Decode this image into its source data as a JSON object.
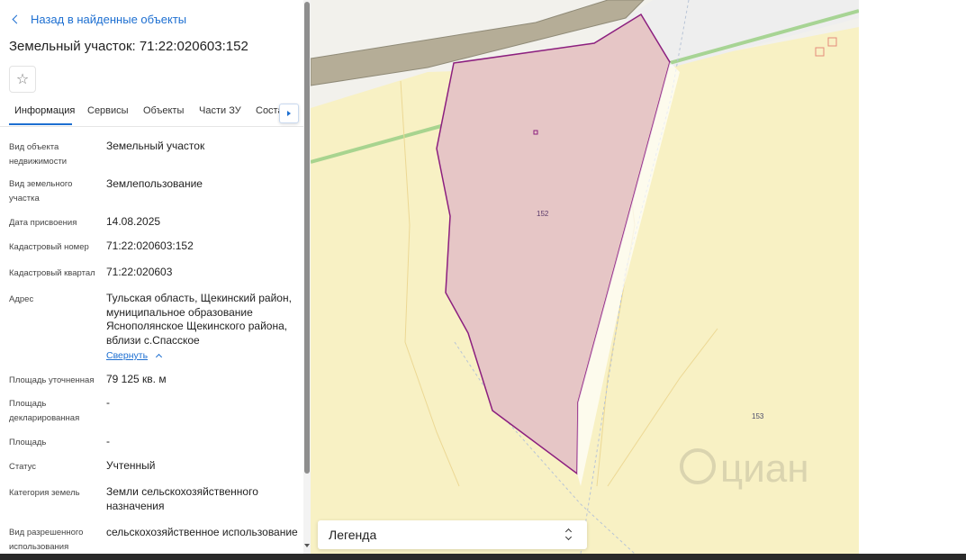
{
  "panel": {
    "back_link": "Назад в найденные объекты",
    "title": "Земельный участок: 71:22:020603:152",
    "tabs": [
      "Информация",
      "Сервисы",
      "Объекты",
      "Части ЗУ",
      "Соста"
    ],
    "active_tab": 0,
    "rows": [
      {
        "label": "Вид объекта недвижимости",
        "value": "Земельный участок"
      },
      {
        "label": "Вид земельного участка",
        "value": "Землепользование"
      },
      {
        "label": "Дата присвоения",
        "value": "14.08.2025"
      },
      {
        "label": "Кадастровый номер",
        "value": "71:22:020603:152"
      },
      {
        "label": "Кадастровый квартал",
        "value": "71:22:020603"
      },
      {
        "label": "Адрес",
        "value": "Тульская область, Щекинский район, муниципальное образование Яснополянское Щекинского района, вблизи с.Спасское"
      },
      {
        "label": "Площадь уточненная",
        "value": "79 125 кв. м"
      },
      {
        "label": "Площадь декларированная",
        "value": "-"
      },
      {
        "label": "Площадь",
        "value": "-"
      },
      {
        "label": "Статус",
        "value": "Учтенный"
      },
      {
        "label": "Категория земель",
        "value": "Земли сельскохозяйственного назначения"
      },
      {
        "label": "Вид разрешенного использования",
        "value": "сельскохозяйственное использование"
      }
    ],
    "collapse_link": "Свернуть"
  },
  "map": {
    "parcel_label": "152",
    "neighbor_label": "153",
    "watermark": "циан",
    "legend_label": "Легенда"
  },
  "colors": {
    "accent": "#1d6fd1",
    "parcel_fill": "#e6c6c6",
    "parcel_stroke": "#8c1f7f",
    "field_fill": "#f8f1c4",
    "road": "#b5ad97",
    "power_line": "#9fd08a"
  },
  "icons": {
    "back": "chevron-left-icon",
    "favorite": "star-icon",
    "tab_next": "chevron-right-icon",
    "collapse": "chevron-up-icon",
    "legend_toggle": "chevron-up-down-icon",
    "watermark": "cian-logo-icon"
  }
}
